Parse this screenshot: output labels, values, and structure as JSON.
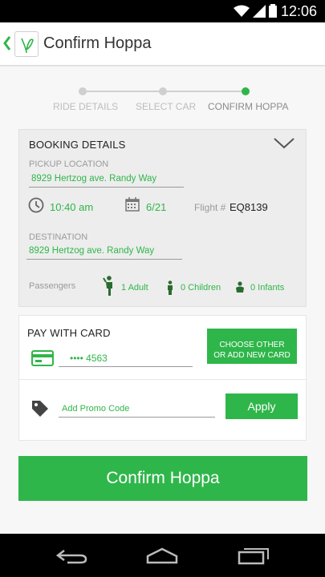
{
  "status_bar": {
    "time": "12:06"
  },
  "app_bar": {
    "title": "Confirm Hoppa"
  },
  "steps": [
    {
      "label": "RIDE DETAILS",
      "active": false
    },
    {
      "label": "SELECT CAR",
      "active": false
    },
    {
      "label": "CONFIRM HOPPA",
      "active": true
    }
  ],
  "booking": {
    "title": "BOOKING DETAILS",
    "pickup_label": "PICKUP LOCATION",
    "pickup_value": "8929 Hertzog ave. Randy Way",
    "time": "10:40 am",
    "date": "6/21",
    "flight_label": "Flight #",
    "flight_value": "EQ8139",
    "destination_label": "DESTINATION",
    "destination_value": "8929 Hertzog ave. Randy Way",
    "passengers_label": "Passengers",
    "adults": "1 Adult",
    "children": "0 Children",
    "infants": "0 Infants"
  },
  "payment": {
    "title": "PAY WITH CARD",
    "card_value": "•••• 4563",
    "choose_card_line1": "CHOOSE OTHER",
    "choose_card_line2": "OR ADD NEW CARD",
    "promo_placeholder": "Add Promo Code",
    "apply_label": "Apply"
  },
  "confirm_label": "Confirm Hoppa",
  "colors": {
    "accent": "#2fb64a",
    "background": "#f7f7f7",
    "card": "#ededed"
  },
  "icons": {
    "back": "chevron-left-icon",
    "logo": "hoppa-logo",
    "expand": "chevron-down-icon",
    "clock": "clock-icon",
    "calendar": "calendar-icon",
    "adult": "adult-icon",
    "child": "child-icon",
    "infant": "infant-icon",
    "card": "credit-card-icon",
    "tag": "tag-icon",
    "nav_back": "nav-back-icon",
    "nav_home": "nav-home-icon",
    "nav_recents": "nav-recents-icon"
  }
}
